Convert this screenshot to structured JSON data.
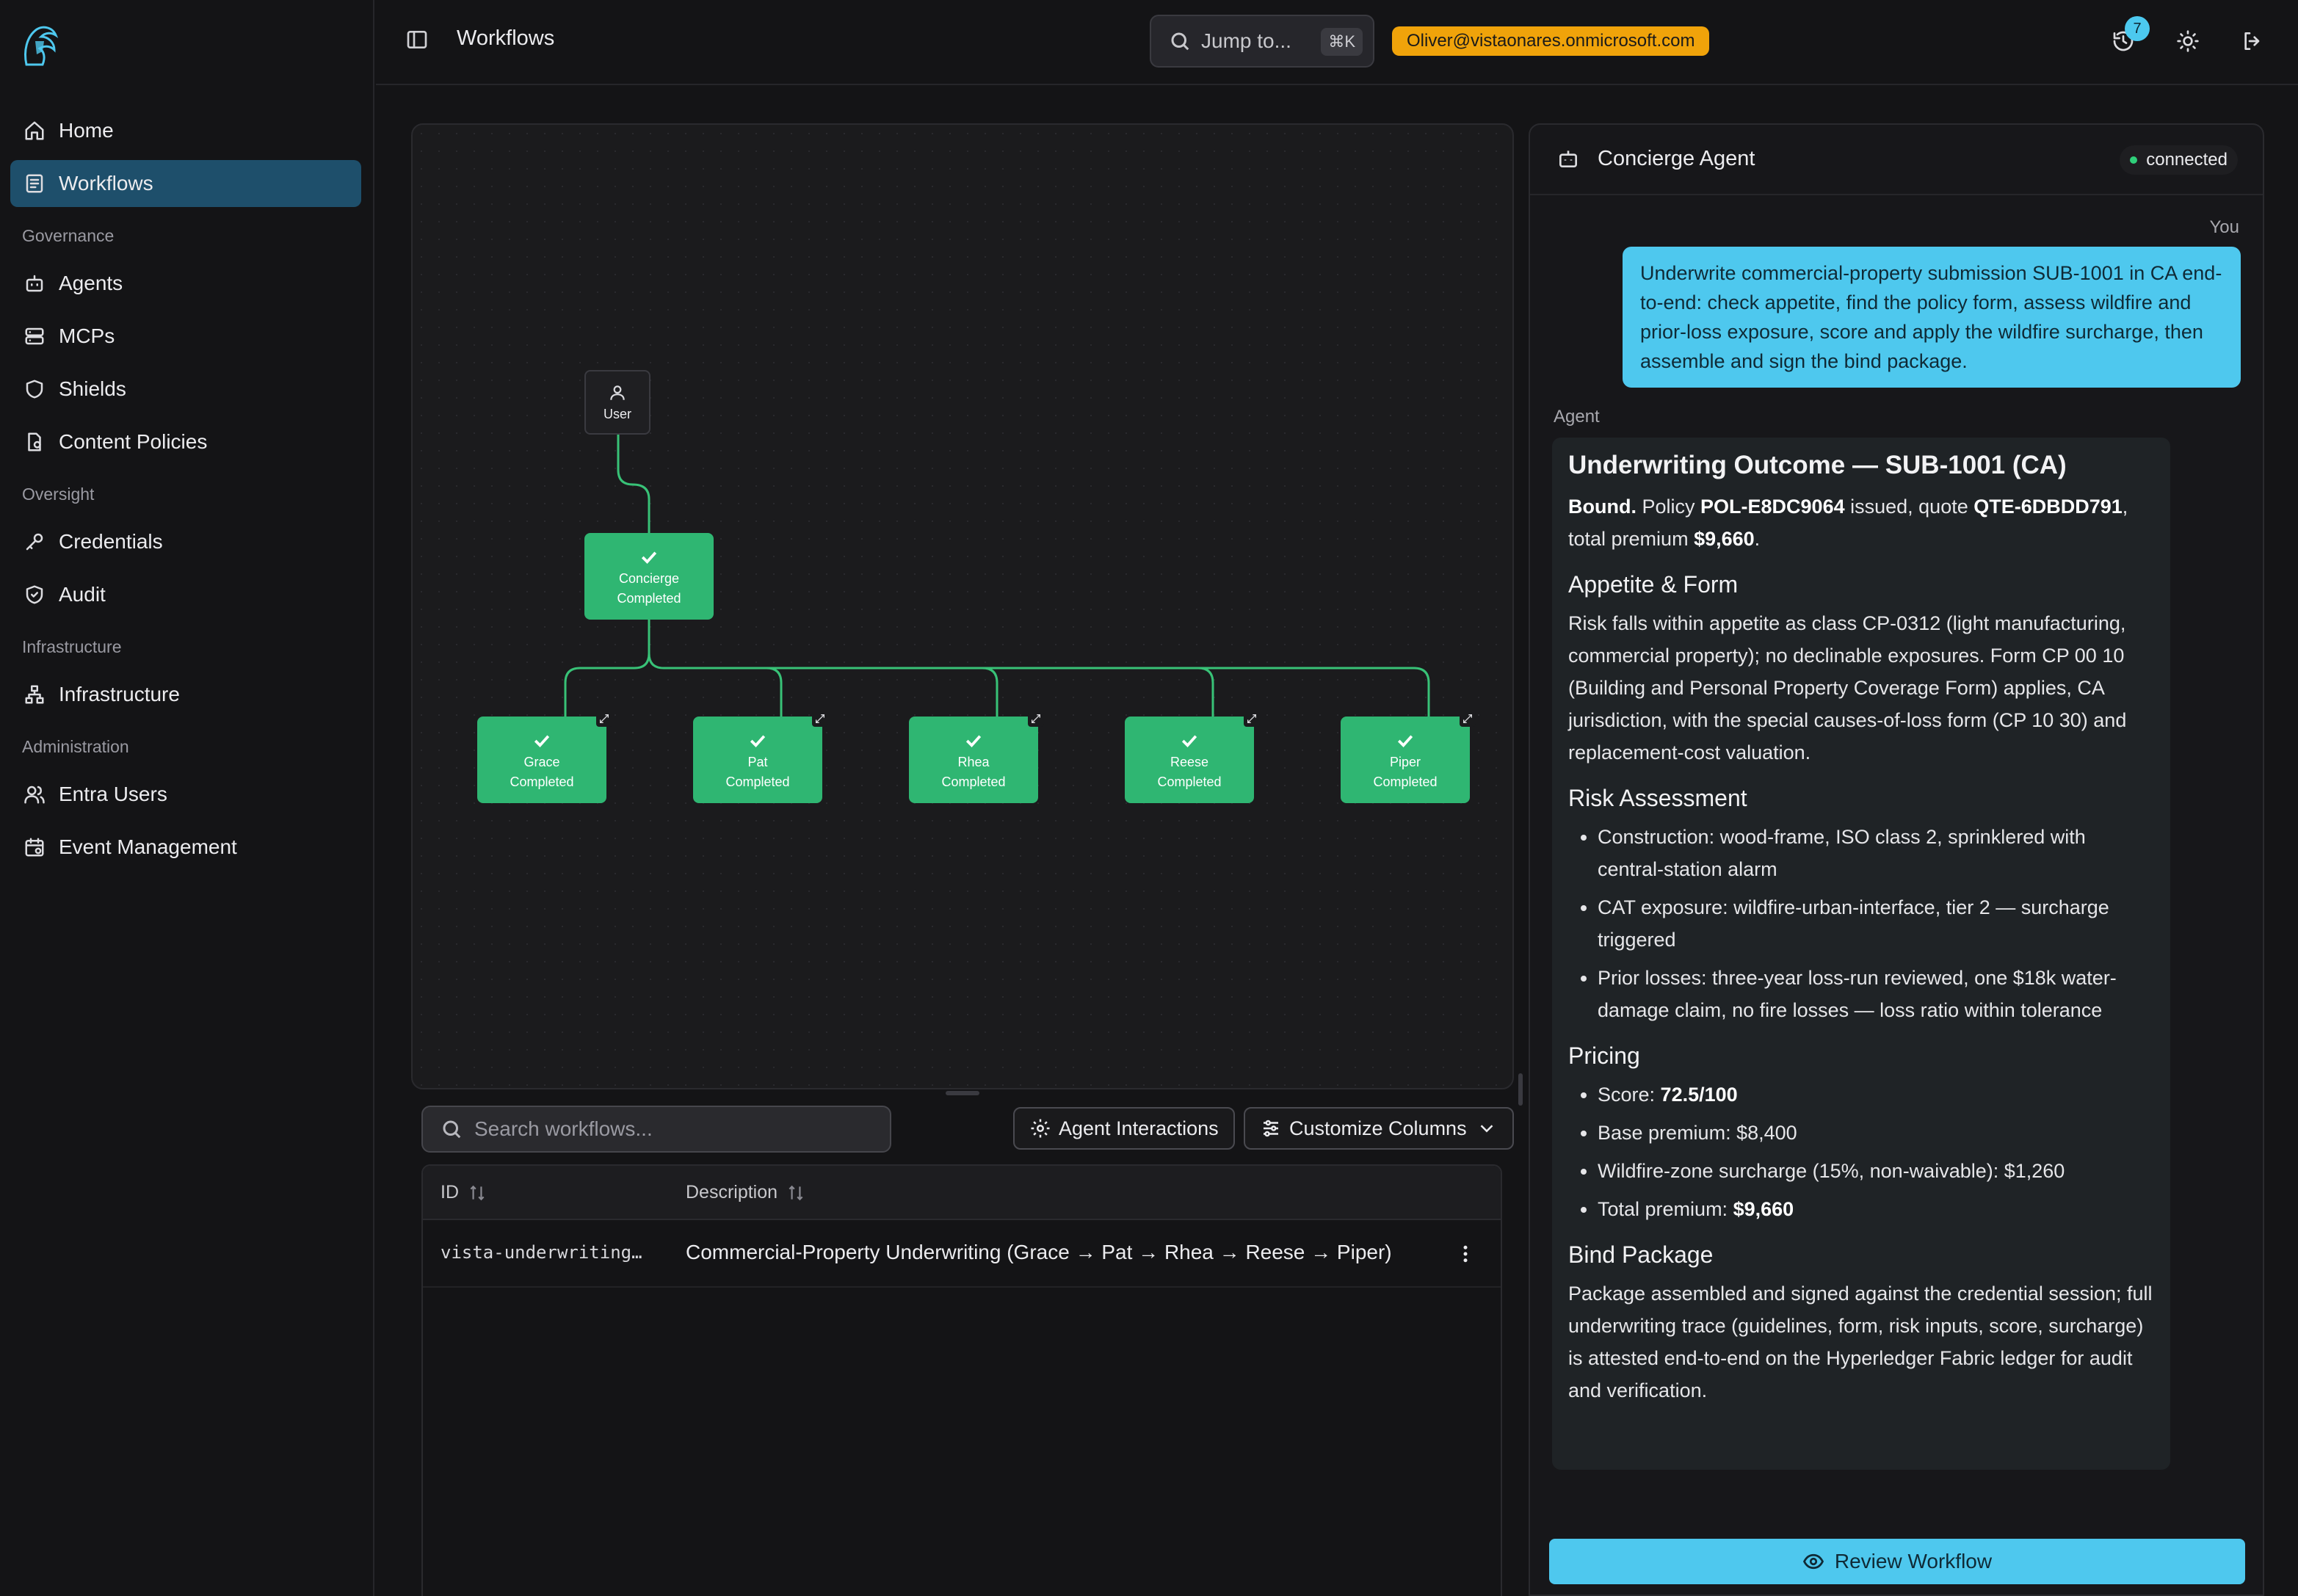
{
  "nav": {
    "items": [
      {
        "label": "Home"
      },
      {
        "label": "Workflows"
      },
      {
        "label": "Agents"
      },
      {
        "label": "MCPs"
      },
      {
        "label": "Shields"
      },
      {
        "label": "Content Policies"
      },
      {
        "label": "Credentials"
      },
      {
        "label": "Audit"
      },
      {
        "label": "Infrastructure"
      },
      {
        "label": "Entra Users"
      },
      {
        "label": "Event Management"
      }
    ],
    "sections": [
      "Governance",
      "Oversight",
      "Infrastructure",
      "Administration"
    ],
    "active": "Workflows"
  },
  "topbar": {
    "title": "Workflows",
    "jump_label": "Jump to...",
    "jump_shortcut": "⌘K",
    "user_email": "Oliver@vistaonares.onmicrosoft.com",
    "notification_count": "7"
  },
  "graph": {
    "user_node": "User",
    "root": {
      "name": "Concierge",
      "status": "Completed"
    },
    "children": [
      {
        "name": "Grace",
        "status": "Completed"
      },
      {
        "name": "Pat",
        "status": "Completed"
      },
      {
        "name": "Rhea",
        "status": "Completed"
      },
      {
        "name": "Reese",
        "status": "Completed"
      },
      {
        "name": "Piper",
        "status": "Completed"
      }
    ],
    "status_color": "#2fb672"
  },
  "table": {
    "search_placeholder": "Search workflows...",
    "agent_interactions_label": "Agent Interactions",
    "customize_columns_label": "Customize Columns",
    "columns": [
      "ID",
      "Description"
    ],
    "rows": [
      {
        "id": "vista-underwriting…",
        "description": "Commercial-Property Underwriting (Grace → Pat → Rhea → Reese → Piper)"
      }
    ]
  },
  "chat": {
    "title": "Concierge Agent",
    "status": "connected",
    "you_label": "You",
    "agent_label": "Agent",
    "user_message": "Underwrite commercial-property submission SUB-1001 in CA end-to-end: check appetite, find the policy form, assess wildfire and prior-loss exposure, score and apply the wildfire surcharge, then assemble and sign the bind package.",
    "response": {
      "heading": "Underwriting Outcome — SUB-1001 (CA)",
      "summary_bold": "Bound.",
      "summary_pre": " Policy ",
      "policy": "POL-E8DC9064",
      "summary_mid": " issued, quote ",
      "quote": "QTE-6DBDD791",
      "summary_post": ", total premium ",
      "premium": "$9,660",
      "summary_end": ".",
      "appetite_heading": "Appetite & Form",
      "appetite_text": "Risk falls within appetite as class CP-0312 (light manufacturing, commercial property); no declinable exposures. Form CP 00 10 (Building and Personal Property Coverage Form) applies, CA jurisdiction, with the special causes-of-loss form (CP 10 30) and replacement-cost valuation.",
      "risk_heading": "Risk Assessment",
      "risk_items": [
        "Construction: wood-frame, ISO class 2, sprinklered with central-station alarm",
        "CAT exposure: wildfire-urban-interface, tier 2 — surcharge triggered",
        "Prior losses: three-year loss-run reviewed, one $18k water-damage claim, no fire losses — loss ratio within tolerance"
      ],
      "pricing_heading": "Pricing",
      "pricing": {
        "score_label": "Score: ",
        "score": "72.5/100",
        "base": "Base premium: $8,400",
        "surcharge": "Wildfire-zone surcharge (15%, non-waivable): $1,260",
        "total_label": "Total premium: ",
        "total": "$9,660"
      },
      "bind_heading": "Bind Package",
      "bind_text": "Package assembled and signed against the credential session; full underwriting trace (guidelines, form, risk inputs, score, surcharge) is attested end-to-end on the Hyperledger Fabric ledger for audit and verification."
    },
    "review_button": "Review Workflow"
  },
  "colors": {
    "accent": "#4ec8ee",
    "badge": "#f0a30a",
    "active_nav": "#1e4f6b",
    "node_complete": "#2fb672"
  },
  "icons": [
    "home-icon",
    "workflows-icon",
    "agents-icon",
    "mcps-icon",
    "shield-icon",
    "content-policy-icon",
    "key-icon",
    "audit-icon",
    "infrastructure-icon",
    "users-icon",
    "event-icon",
    "sidebar-toggle-icon",
    "search-icon",
    "history-icon",
    "sun-icon",
    "logout-icon",
    "bot-icon",
    "user-icon",
    "check-icon",
    "external-link-icon",
    "gear-icon",
    "sliders-icon",
    "chevron-down-icon",
    "sort-icon",
    "more-vertical-icon",
    "eye-icon"
  ]
}
